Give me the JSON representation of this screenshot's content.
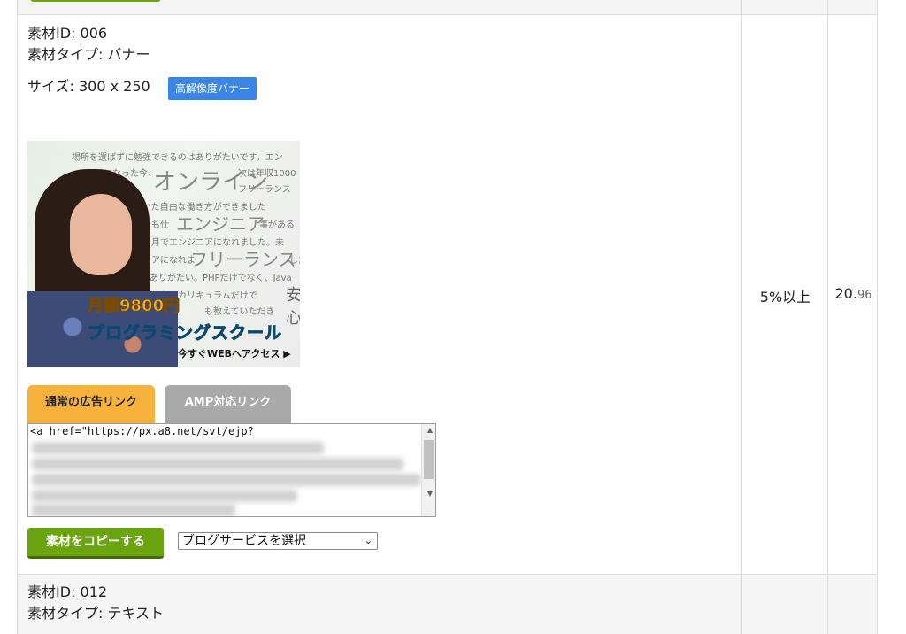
{
  "item": {
    "id_label": "素材ID: 006",
    "type_label": "素材タイプ: バナー",
    "size_label": "サイズ: 300 x 250",
    "badge": "高解像度バナー",
    "banner": {
      "bg_lines": [
        "場所を選ばずに勉強できるのはありがたいです。エン",
        "ジニアになった今、",
        "次は年収1000",
        "ます。",
        "フリーランス",
        "としていた自由な働き方ができました",
        "クでも仕",
        "事がある",
        "ヶ月でエンジニアになれました。未",
        "ニアになれま",
        "した",
        "ありがたい。PHPだけでなく、Java",
        "た。カリキュラムだけで",
        "も教えていただき"
      ],
      "big_words": [
        "オンライン",
        "エンジニア",
        "フリーランス",
        "安心"
      ],
      "price": "月額9800円",
      "school": "プログラミングスクール",
      "access": "今すぐWEBへアクセス ▶"
    },
    "tabs": {
      "normal": "通常の広告リンク",
      "amp": "AMP対応リンク"
    },
    "code_first_line": "<a href=\"https://px.a8.net/svt/ejp?",
    "copy_button": "素材をコピーする",
    "blog_select": "ブログサービスを選択",
    "reward_rate": "5%以上",
    "epc_main": "20.",
    "epc_decimal": "96"
  },
  "next_item": {
    "id_label": "素材ID: 012",
    "type_label": "素材タイプ: テキスト"
  }
}
